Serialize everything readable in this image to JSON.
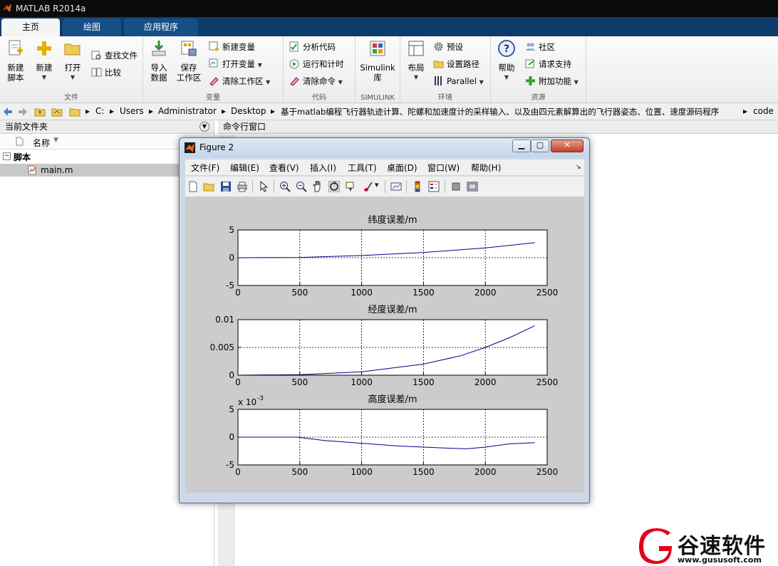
{
  "app": {
    "title": "MATLAB R2014a"
  },
  "tabs": [
    "主页",
    "绘图",
    "应用程序"
  ],
  "ribbon": {
    "file": {
      "group_label": "文件",
      "new_script": "新建\n脚本",
      "new": "新建",
      "open": "打开",
      "find_files": "查找文件",
      "compare": "比较"
    },
    "variable": {
      "group_label": "变量",
      "import_data": "导入\n数据",
      "save_workspace": "保存\n工作区",
      "new_variable": "新建变量",
      "open_variable": "打开变量",
      "clear_workspace": "清除工作区"
    },
    "code": {
      "group_label": "代码",
      "analyze_code": "分析代码",
      "run_and_time": "运行和计时",
      "clear_commands": "清除命令"
    },
    "simulink": {
      "group_label": "SIMULINK",
      "library": "Simulink\n库"
    },
    "environment": {
      "group_label": "环境",
      "layout": "布局",
      "preferences": "预设",
      "set_path": "设置路径",
      "parallel": "Parallel"
    },
    "resources": {
      "group_label": "资源",
      "help": "帮助",
      "community": "社区",
      "request_support": "请求支持",
      "addons": "附加功能"
    }
  },
  "address": {
    "segments": [
      "C:",
      "Users",
      "Administrator",
      "Desktop",
      "基于matlab编程飞行器轨迹计算、陀螺和加速度计的采样输入、以及由四元素解算出的飞行器姿态、位置、速度源码程序",
      "code"
    ]
  },
  "current_folder": {
    "title": "当前文件夹",
    "column_name": "名称",
    "group": "脚本",
    "files": [
      "main.m"
    ]
  },
  "command_window": {
    "title": "命令行窗口"
  },
  "figure": {
    "title": "Figure 2",
    "menus": [
      "文件(F)",
      "编辑(E)",
      "查看(V)",
      "插入(I)",
      "工具(T)",
      "桌面(D)",
      "窗口(W)",
      "帮助(H)"
    ]
  },
  "chart_data": [
    {
      "type": "line",
      "title": "纬度误差/m",
      "xlim": [
        0,
        2500
      ],
      "ylim": [
        -5,
        5
      ],
      "xticks": [
        "0",
        "500",
        "1000",
        "1500",
        "2000",
        "2500"
      ],
      "yticks": [
        "5",
        "0",
        "-5"
      ],
      "grid": true,
      "series": [
        {
          "x": [
            0,
            500,
            1000,
            1500,
            2000,
            2400
          ],
          "y": [
            0,
            0.05,
            0.4,
            0.95,
            1.75,
            2.7
          ],
          "color": "#00008b"
        }
      ]
    },
    {
      "type": "line",
      "title": "经度误差/m",
      "xlim": [
        0,
        2500
      ],
      "ylim": [
        0,
        0.01
      ],
      "xticks": [
        "0",
        "500",
        "1000",
        "1500",
        "2000",
        "2500"
      ],
      "yticks": [
        "0.01",
        "0.005",
        "0"
      ],
      "grid": true,
      "series": [
        {
          "x": [
            0,
            500,
            1000,
            1500,
            1800,
            2000,
            2200,
            2400
          ],
          "y": [
            0,
            0.0001,
            0.0006,
            0.002,
            0.0035,
            0.005,
            0.0068,
            0.0089
          ],
          "color": "#00008b"
        }
      ]
    },
    {
      "type": "line",
      "title": "高度误差/m",
      "exponent_label": "x 10",
      "exponent_power": "-3",
      "xlim": [
        0,
        2500
      ],
      "ylim": [
        -5,
        5
      ],
      "xticks": [
        "0",
        "500",
        "1000",
        "1500",
        "2000",
        "2500"
      ],
      "yticks": [
        "5",
        "0",
        "-5"
      ],
      "grid": true,
      "series": [
        {
          "x": [
            0,
            480,
            700,
            1000,
            1300,
            1600,
            1850,
            2000,
            2200,
            2400
          ],
          "y": [
            0,
            0,
            -0.6,
            -1.1,
            -1.6,
            -1.9,
            -2.1,
            -1.8,
            -1.2,
            -1.0
          ],
          "color": "#00008b"
        }
      ]
    }
  ],
  "watermark": {
    "brand": "谷速软件",
    "url": "www.gususoft.com"
  },
  "colors": {
    "accent_tabs": "#0e3c6a",
    "line": "#00008b",
    "watermark_red": "#e2001a"
  }
}
